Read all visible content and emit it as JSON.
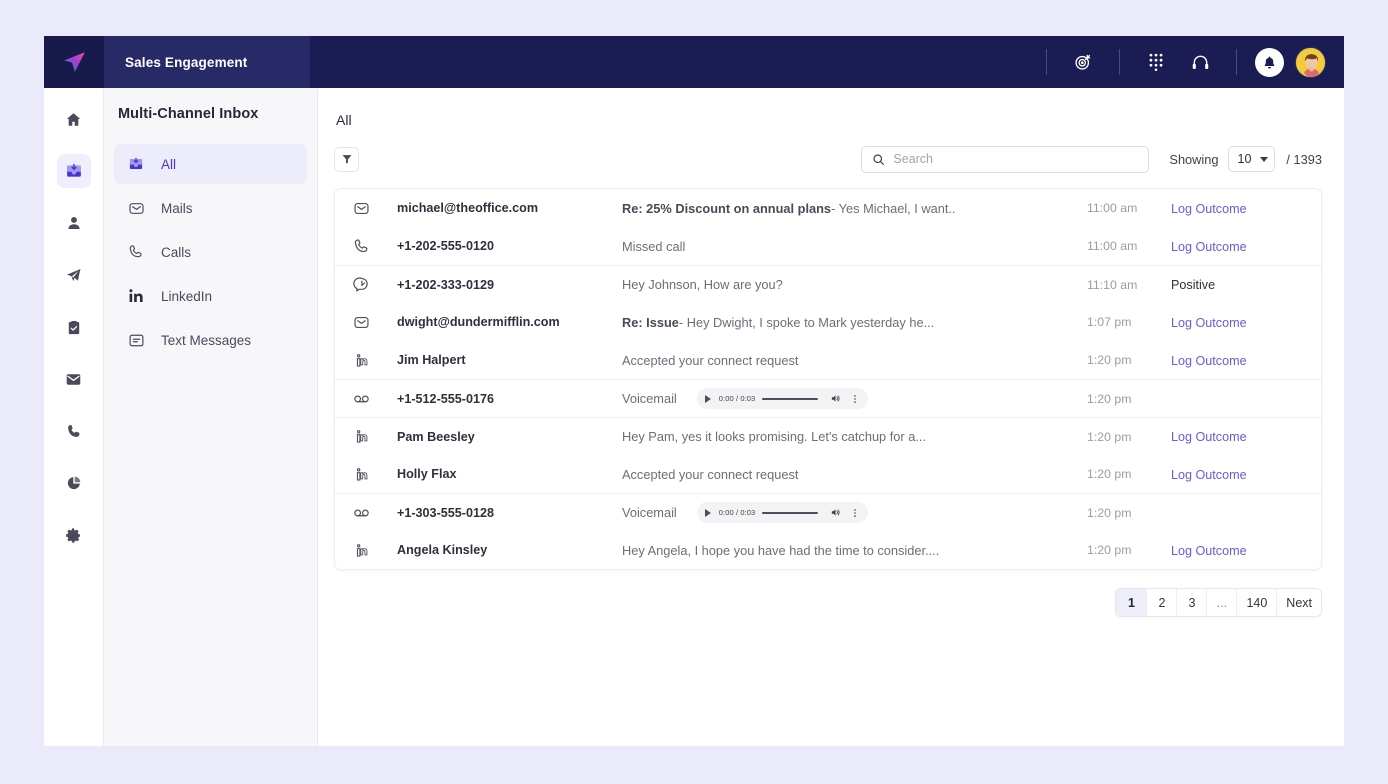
{
  "topbar": {
    "logo_icon": "paper-plane-logo-icon",
    "brand_title": "Sales Engagement",
    "icons": [
      {
        "name": "target-icon"
      },
      {
        "name": "dialpad-icon"
      },
      {
        "name": "headset-icon"
      },
      {
        "name": "bell-icon"
      },
      {
        "name": "user-avatar"
      }
    ]
  },
  "rail": {
    "items": [
      {
        "icon": "home-icon",
        "active": false
      },
      {
        "icon": "inbox-icon",
        "active": true
      },
      {
        "icon": "person-icon",
        "active": false
      },
      {
        "icon": "paper-plane-icon",
        "active": false
      },
      {
        "icon": "clipboard-check-icon",
        "active": false
      },
      {
        "icon": "mail-icon",
        "active": false
      },
      {
        "icon": "phone-icon",
        "active": false
      },
      {
        "icon": "pie-chart-icon",
        "active": false
      },
      {
        "icon": "gear-icon",
        "active": false
      }
    ]
  },
  "nav": {
    "title": "Multi-Channel Inbox",
    "items": [
      {
        "label": "All",
        "icon": "inbox-icon",
        "active": true
      },
      {
        "label": "Mails",
        "icon": "mail-icon",
        "active": false
      },
      {
        "label": "Calls",
        "icon": "phone-icon",
        "active": false
      },
      {
        "label": "LinkedIn",
        "icon": "linkedin-icon",
        "active": false
      },
      {
        "label": "Text Messages",
        "icon": "message-icon",
        "active": false
      }
    ]
  },
  "main": {
    "heading": "All",
    "filter_icon": "filter-icon",
    "search": {
      "value": "",
      "placeholder": "Search",
      "icon": "search-icon"
    },
    "showing": {
      "label": "Showing",
      "value": "10",
      "total": "/ 1393"
    }
  },
  "table": {
    "rows": [
      {
        "icon": "email-icon",
        "who": "michael@theoffice.com",
        "subject": "Re: 25% Discount on annual plans",
        "preview": " - Yes Michael, I want..",
        "time": "11:00 am",
        "outcome": "Log Outcome",
        "outcome_type": "link",
        "separator": false,
        "audio": null
      },
      {
        "icon": "phone-icon",
        "who": "+1-202-555-0120",
        "subject": "",
        "preview": "Missed call",
        "time": "11:00 am",
        "outcome": "Log Outcome",
        "outcome_type": "link",
        "separator": false,
        "audio": null
      },
      {
        "icon": "sms-icon",
        "who": "+1-202-333-0129",
        "subject": "",
        "preview": "Hey Johnson, How are you?",
        "time": "11:10 am",
        "outcome": "Positive",
        "outcome_type": "plain",
        "separator": true,
        "audio": null
      },
      {
        "icon": "email-icon",
        "who": "dwight@dundermifflin.com",
        "subject": "Re: Issue",
        "preview": " - Hey Dwight, I spoke to Mark yesterday he...",
        "time": "1:07 pm",
        "outcome": "Log Outcome",
        "outcome_type": "link",
        "separator": false,
        "audio": null
      },
      {
        "icon": "linkedin-icon",
        "who": "Jim Halpert",
        "subject": "",
        "preview": "Accepted your connect request",
        "time": "1:20 pm",
        "outcome": "Log Outcome",
        "outcome_type": "link",
        "separator": false,
        "audio": null
      },
      {
        "icon": "voicemail-icon",
        "who": "+1-512-555-0176",
        "subject": "",
        "preview": "Voicemail",
        "time": "1:20 pm",
        "outcome": "",
        "outcome_type": "none",
        "separator": true,
        "audio": {
          "time": "0:00 / 0:03"
        }
      },
      {
        "icon": "linkedin-icon",
        "who": "Pam Beesley",
        "subject": "",
        "preview": "Hey Pam, yes it looks promising. Let's catchup for a...",
        "time": "1:20 pm",
        "outcome": "Log Outcome",
        "outcome_type": "link",
        "separator": true,
        "audio": null
      },
      {
        "icon": "linkedin-icon",
        "who": "Holly Flax",
        "subject": "",
        "preview": "Accepted your connect request",
        "time": "1:20 pm",
        "outcome": "Log Outcome",
        "outcome_type": "link",
        "separator": false,
        "audio": null
      },
      {
        "icon": "voicemail-icon",
        "who": "+1-303-555-0128",
        "subject": "",
        "preview": "Voicemail",
        "time": "1:20 pm",
        "outcome": "",
        "outcome_type": "none",
        "separator": true,
        "audio": {
          "time": "0:00 / 0:03"
        }
      },
      {
        "icon": "linkedin-icon",
        "who": "Angela Kinsley",
        "subject": "",
        "preview": "Hey Angela, I hope you have had the time to consider....",
        "time": "1:20 pm",
        "outcome": "Log Outcome",
        "outcome_type": "link",
        "separator": false,
        "audio": null
      }
    ]
  },
  "pagination": {
    "pages": [
      "1",
      "2",
      "3",
      "...",
      "140",
      "Next"
    ],
    "current": "1"
  },
  "colors": {
    "accent": "#6a5ae0",
    "header_bg": "#1b1c54",
    "brand_bg": "#282a68",
    "page_bg": "#ebeafb",
    "active_nav_bg": "#ececfb"
  }
}
